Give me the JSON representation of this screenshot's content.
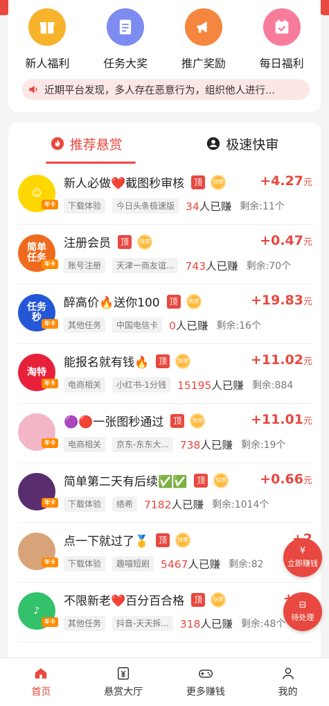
{
  "colors": {
    "accent": "#e8483f",
    "tag_bg": "#f2f2f2",
    "notice_bg": "#fde6e6"
  },
  "quick": [
    {
      "label": "新人福利",
      "icon": "gift-box-icon",
      "color": "#f7b32b"
    },
    {
      "label": "任务大奖",
      "icon": "document-icon",
      "color": "#7d8cf0"
    },
    {
      "label": "推广奖励",
      "icon": "megaphone-icon",
      "color": "#f5863f"
    },
    {
      "label": "每日福利",
      "icon": "calendar-check-icon",
      "color": "#f77c9b"
    }
  ],
  "notice": {
    "icon": "speaker-icon",
    "text": "近期平台发现，多人存在恶意行为，组织他人进行..."
  },
  "tabs": [
    {
      "label": "推荐悬赏",
      "icon": "flame-icon",
      "active": true
    },
    {
      "label": "极速快审",
      "icon": "user-icon",
      "active": false
    }
  ],
  "badges": {
    "top": "顶",
    "fast": "快审",
    "vip": "年卡"
  },
  "tasks": [
    {
      "title": "新人必做❤️截图秒审核",
      "tags": [
        "下载体验",
        "今日头条极速版"
      ],
      "earned": "34",
      "earned_suffix": "人已赚",
      "remain": "剩余:11个",
      "price_prefix": "+",
      "price": "4.27",
      "unit": "元",
      "avatar_bg": "#ffd700",
      "avatar_text": "☺"
    },
    {
      "title": "注册会员",
      "tags": [
        "账号注册",
        "天津一商友谊..."
      ],
      "earned": "743",
      "earned_suffix": "人已赚",
      "remain": "剩余:70个",
      "price_prefix": "+",
      "price": "0.47",
      "unit": "元",
      "avatar_bg": "#f06a1e",
      "avatar_text": "简单\n任务"
    },
    {
      "title": "醉高价🔥送你100",
      "tags": [
        "其他任务",
        "中国电信卡"
      ],
      "earned": "0",
      "earned_suffix": "人已赚",
      "remain": "剩余:16个",
      "price_prefix": "+",
      "price": "19.83",
      "unit": "元",
      "avatar_bg": "#2456d6",
      "avatar_text": "任务\n秒"
    },
    {
      "title": "能报名就有钱🔥",
      "tags": [
        "电商相关",
        "小红书-1分钱"
      ],
      "earned": "15195",
      "earned_suffix": "人已赚",
      "remain": "剩余:884",
      "price_prefix": "+",
      "price": "11.02",
      "unit": "元",
      "avatar_bg": "#e8213b",
      "avatar_text": "淘特"
    },
    {
      "title": "🟣🔴一张图秒通过",
      "tags": [
        "电商相关",
        "京东-东东大..."
      ],
      "earned": "738",
      "earned_suffix": "人已赚",
      "remain": "剩余:19个",
      "price_prefix": "+",
      "price": "11.01",
      "unit": "元",
      "avatar_bg": "#f3b6c6",
      "avatar_text": ""
    },
    {
      "title": "简单第二天有后续✅✅",
      "tags": [
        "下载体验",
        "络希"
      ],
      "earned": "7182",
      "earned_suffix": "人已赚",
      "remain": "剩余:1014个",
      "price_prefix": "+",
      "price": "0.66",
      "unit": "元",
      "avatar_bg": "#5a2d6e",
      "avatar_text": ""
    },
    {
      "title": "点一下就过了🥇",
      "tags": [
        "下载体验",
        "趣喵短剧"
      ],
      "earned": "5467",
      "earned_suffix": "人已赚",
      "remain": "剩余:82",
      "price_prefix": "+",
      "price": "2",
      "unit": "",
      "avatar_bg": "#d9a37a",
      "avatar_text": ""
    },
    {
      "title": "不限新老❤️百分百合格",
      "tags": [
        "其他任务",
        "抖音-天天拆..."
      ],
      "earned": "318",
      "earned_suffix": "人已赚",
      "remain": "剩余:48个",
      "price_prefix": "+",
      "price": "21",
      "unit": "",
      "avatar_bg": "#33c26b",
      "avatar_text": "♪"
    }
  ],
  "floats": [
    {
      "icon": "¥",
      "label": "立即赚钱",
      "name": "earn-now-button"
    },
    {
      "icon": "⊟",
      "label": "待处理",
      "name": "pending-button"
    }
  ],
  "tabbar": [
    {
      "label": "首页",
      "icon": "home-icon",
      "active": true
    },
    {
      "label": "悬赏大厅",
      "icon": "yuan-icon",
      "active": false
    },
    {
      "label": "更多赚钱",
      "icon": "gamepad-icon",
      "active": false
    },
    {
      "label": "我的",
      "icon": "person-icon",
      "active": false
    }
  ]
}
